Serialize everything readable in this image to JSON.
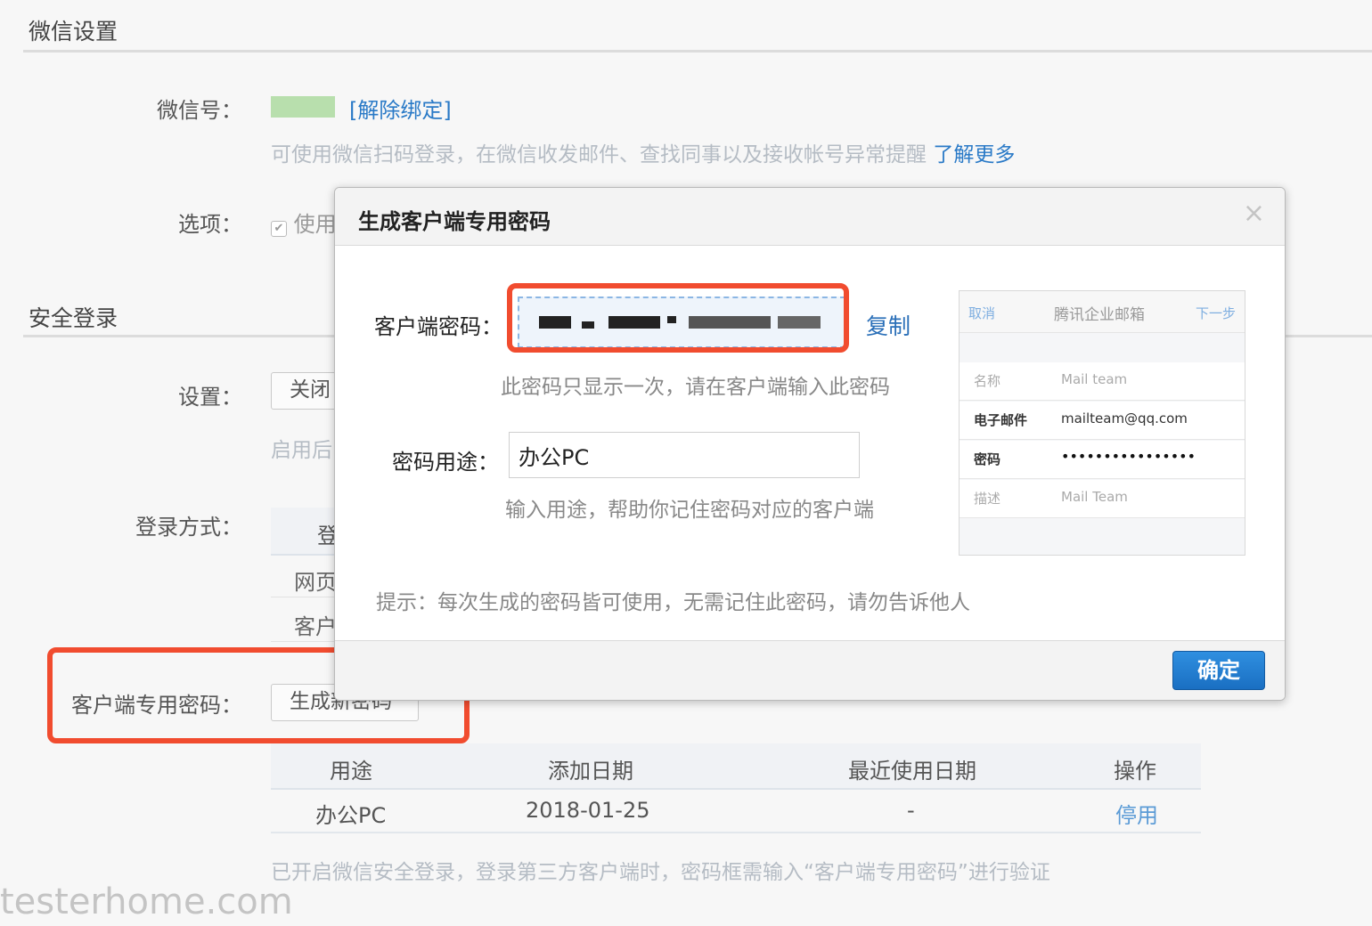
{
  "wechat_section": {
    "title": "微信设置",
    "account_label": "微信号：",
    "unbind_link": "[解除绑定]",
    "description": "可使用微信扫码登录，在微信收发邮件、查找同事以及接收帐号异常提醒",
    "learn_more": "了解更多",
    "options_label": "选项：",
    "option_partial": "使用"
  },
  "security_section": {
    "title": "安全登录",
    "setting_label": "设置：",
    "setting_value": "关闭",
    "enabled_hint_partial": "启用后",
    "login_method_label": "登录方式：",
    "login_table_head_partial": "登",
    "login_rows_partial": [
      "网页",
      "客户"
    ],
    "client_password_label": "客户端专用密码：",
    "generate_button": "生成新密码"
  },
  "password_table": {
    "headers": [
      "用途",
      "添加日期",
      "最近使用日期",
      "操作"
    ],
    "rows": [
      {
        "purpose": "办公PC",
        "added": "2018-01-25",
        "last_used": "-",
        "action": "停用"
      }
    ]
  },
  "footer_note": "已开启微信安全登录，登录第三方客户端时，密码框需输入“客户端专用密码”进行验证",
  "watermark": "testerhome.com",
  "modal": {
    "title": "生成客户端专用密码",
    "close": "×",
    "password_label": "客户端密码：",
    "copy_link": "复制",
    "password_note": "此密码只显示一次，请在客户端输入此密码",
    "purpose_label": "密码用途：",
    "purpose_value": "办公PC",
    "purpose_hint": "输入用途，帮助你记住密码对应的客户端",
    "tip": "提示：每次生成的密码皆可使用，无需记住此密码，请勿告诉他人",
    "ok_button": "确定",
    "preview": {
      "cancel": "取消",
      "title": "腾讯企业邮箱",
      "next": "下一步",
      "rows": [
        {
          "key": "名称",
          "value": "Mail team"
        },
        {
          "key": "电子邮件",
          "value": "mailteam@qq.com"
        },
        {
          "key": "密码",
          "value": "••••••••••••••••"
        },
        {
          "key": "描述",
          "value": "Mail Team"
        }
      ]
    }
  },
  "colors": {
    "accent": "#2a7ac7",
    "highlight": "#f14c2f",
    "muted": "#b5bcc4"
  }
}
